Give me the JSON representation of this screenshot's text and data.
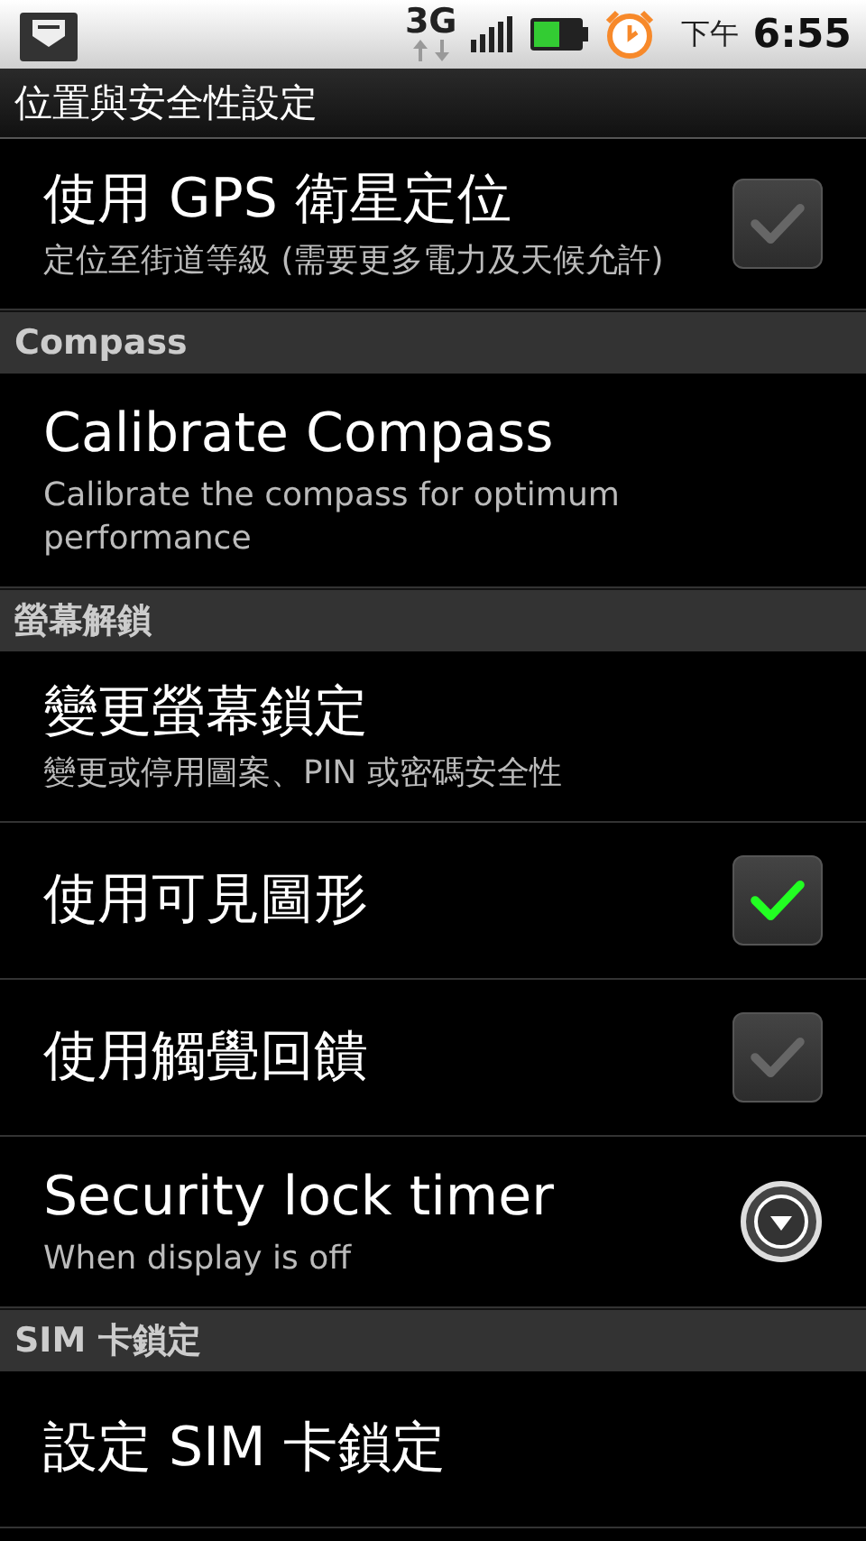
{
  "status_bar": {
    "network": "3G",
    "period": "下午",
    "time": "6:55"
  },
  "title_bar": {
    "title": "位置與安全性設定"
  },
  "items": [
    {
      "kind": "pref",
      "title": "使用 GPS 衛星定位",
      "summary": "定位至街道等級 (需要更多電力及天候允許)",
      "control": {
        "kind": "checkbox",
        "checked": false
      }
    },
    {
      "kind": "header",
      "title": "Compass"
    },
    {
      "kind": "pref",
      "title": "Calibrate Compass",
      "summary": "Calibrate the compass for optimum performance"
    },
    {
      "kind": "header",
      "title": "螢幕解鎖"
    },
    {
      "kind": "pref",
      "title": "變更螢幕鎖定",
      "summary": "變更或停用圖案、PIN 或密碼安全性"
    },
    {
      "kind": "pref",
      "title": "使用可見圖形",
      "control": {
        "kind": "checkbox",
        "checked": true
      }
    },
    {
      "kind": "pref",
      "title": "使用觸覺回饋",
      "control": {
        "kind": "checkbox",
        "checked": false
      }
    },
    {
      "kind": "pref",
      "title": "Security lock timer",
      "summary": "When display is off",
      "control": {
        "kind": "dropdown"
      }
    },
    {
      "kind": "header",
      "title": "SIM 卡鎖定"
    },
    {
      "kind": "pref",
      "title": "設定 SIM 卡鎖定"
    }
  ]
}
